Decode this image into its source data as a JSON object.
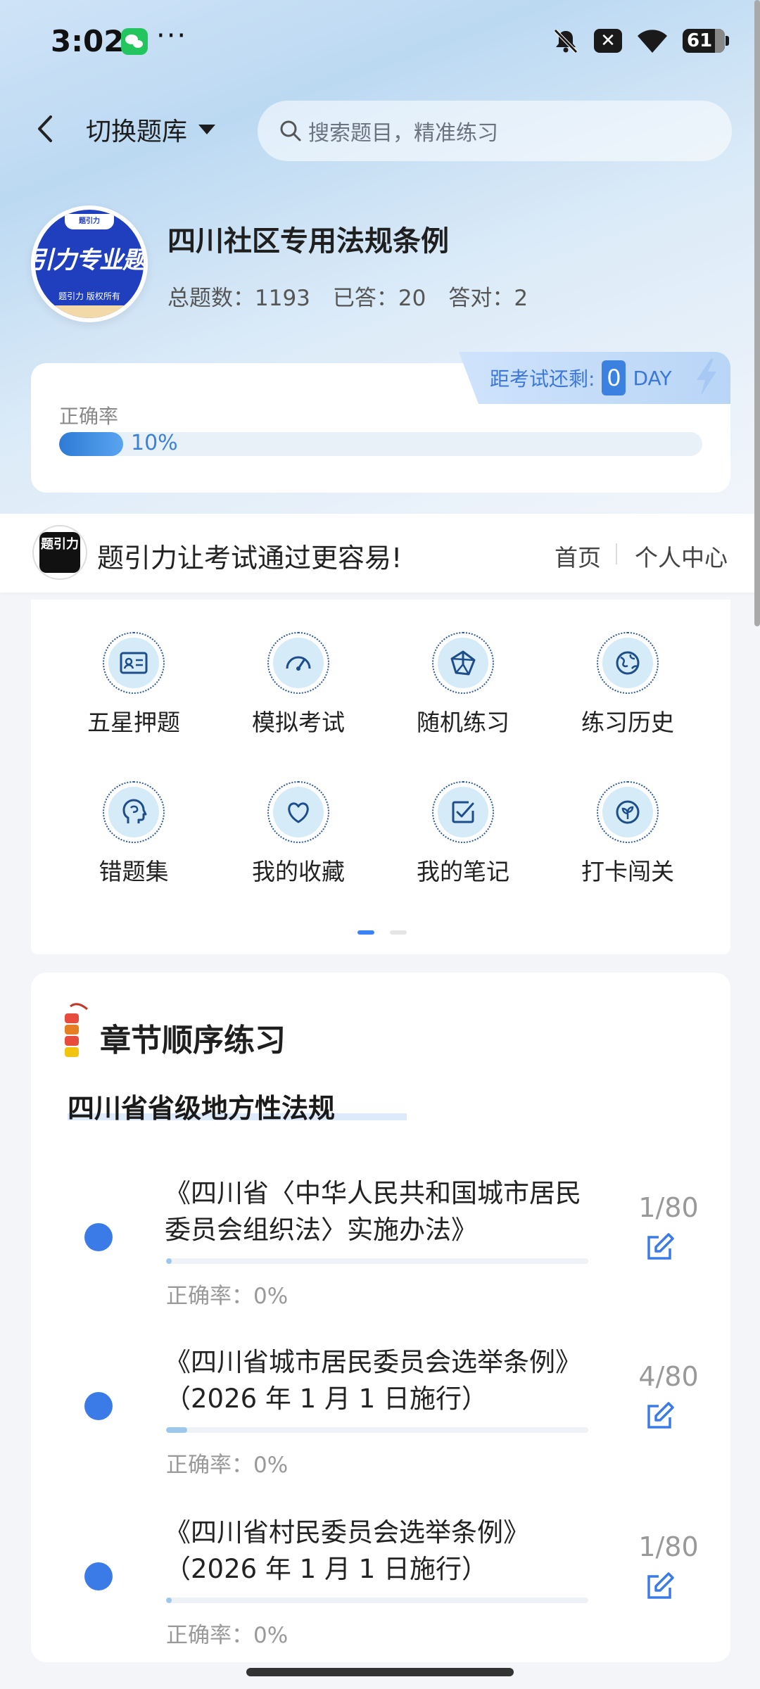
{
  "status_bar": {
    "time": "3:02",
    "battery": "61"
  },
  "nav": {
    "switch_label": "切换题库",
    "search_placeholder": "搜索题目，精准练习"
  },
  "bank": {
    "logo_text": "引力专业题",
    "logo_top": "题引力",
    "logo_sub": "题引力 版权所有",
    "title": "四川社区专用法规条例",
    "stats": [
      {
        "label": "总题数：",
        "value": "1193"
      },
      {
        "label": "已答：",
        "value": "20"
      },
      {
        "label": "答对：",
        "value": "2"
      }
    ]
  },
  "accuracy": {
    "label": "正确率",
    "percent_text": "10%",
    "fraction": 0.1,
    "exam_label": "距考试还剩:",
    "exam_days": "0",
    "exam_unit": "DAY"
  },
  "slogan": {
    "logo_text": "题引力",
    "text": "题引力让考试通过更容易!",
    "home_link": "首页",
    "profile_link": "个人中心"
  },
  "grid": [
    {
      "label": "五星押题",
      "icon": "id-card-icon"
    },
    {
      "label": "模拟考试",
      "icon": "gauge-icon"
    },
    {
      "label": "随机练习",
      "icon": "random-icon"
    },
    {
      "label": "练习历史",
      "icon": "globe-icon"
    },
    {
      "label": "错题集",
      "icon": "brain-icon"
    },
    {
      "label": "我的收藏",
      "icon": "heart-icon"
    },
    {
      "label": "我的笔记",
      "icon": "note-check-icon"
    },
    {
      "label": "打卡闯关",
      "icon": "leaf-icon"
    }
  ],
  "chapters": {
    "title": "章节顺序练习",
    "section": "四川省省级地方性法规",
    "accuracy_label": "正确率：",
    "items": [
      {
        "name": "《四川省〈中华人民共和国城市居民委员会组织法〉实施办法》",
        "count": "1/80",
        "accuracy": "0%",
        "progress": 0.0125
      },
      {
        "name": "《四川省城市居民委员会选举条例》（2026 年 1 月 1 日施行）",
        "count": "4/80",
        "accuracy": "0%",
        "progress": 0.05
      },
      {
        "name": "《四川省村民委员会选举条例》（2026 年 1 月 1 日施行）",
        "count": "1/80",
        "accuracy": "0%",
        "progress": 0.0125
      }
    ]
  },
  "colors": {
    "accent": "#3b7be8",
    "progress": "#2e7ad6"
  }
}
